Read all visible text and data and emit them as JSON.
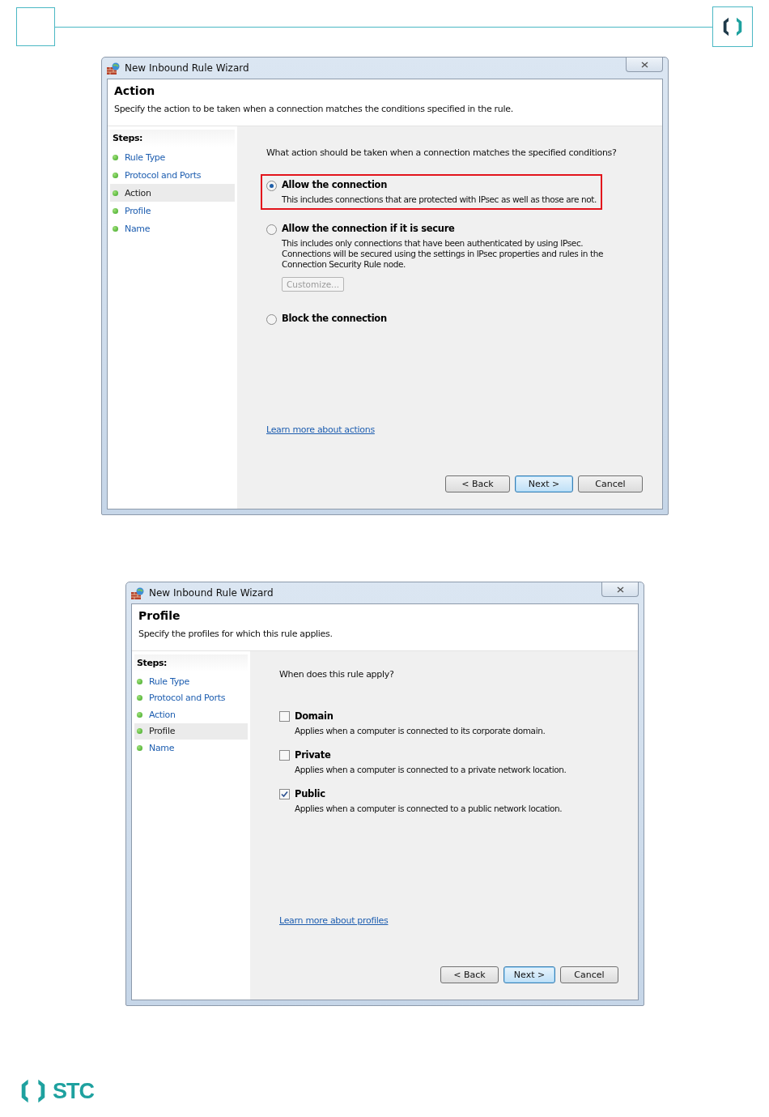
{
  "header": {
    "logo": true
  },
  "windows": [
    {
      "title": "New Inbound Rule Wizard",
      "heading": "Action",
      "subtitle": "Specify the action to be taken when a connection matches the conditions specified in the rule.",
      "steps_label": "Steps:",
      "steps": [
        {
          "label": "Rule Type",
          "selected": false
        },
        {
          "label": "Protocol and Ports",
          "selected": false
        },
        {
          "label": "Action",
          "selected": true
        },
        {
          "label": "Profile",
          "selected": false
        },
        {
          "label": "Name",
          "selected": false
        }
      ],
      "question": "What action should be taken when a connection matches the specified conditions?",
      "options": [
        {
          "kind": "radio",
          "label": "Allow the connection",
          "description": "This includes connections that are protected with IPsec as well as those are not.",
          "selected": true,
          "highlighted": true
        },
        {
          "kind": "radio",
          "label": "Allow the connection if it is secure",
          "description": "This includes only connections that have been authenticated by using IPsec.  Connections will be secured using the settings in IPsec properties and rules in the Connection Security Rule node.",
          "selected": false,
          "highlighted": false,
          "button": {
            "label": "Customize...",
            "disabled": true
          }
        },
        {
          "kind": "radio",
          "label": "Block the connection",
          "selected": false,
          "highlighted": false
        }
      ],
      "link": "Learn more about actions",
      "buttons": [
        {
          "label": "< Back",
          "default": false
        },
        {
          "label": "Next >",
          "default": true
        },
        {
          "label": "Cancel",
          "default": false
        }
      ]
    },
    {
      "title": "New Inbound Rule Wizard",
      "heading": "Profile",
      "subtitle": "Specify the profiles for which this rule applies.",
      "steps_label": "Steps:",
      "steps": [
        {
          "label": "Rule Type",
          "selected": false
        },
        {
          "label": "Protocol and Ports",
          "selected": false
        },
        {
          "label": "Action",
          "selected": false
        },
        {
          "label": "Profile",
          "selected": true
        },
        {
          "label": "Name",
          "selected": false
        }
      ],
      "question": "When does this rule apply?",
      "options": [
        {
          "kind": "checkbox",
          "label": "Domain",
          "description": "Applies when a computer is connected to its corporate domain.",
          "checked": false
        },
        {
          "kind": "checkbox",
          "label": "Private",
          "description": "Applies when a computer is connected to a private network location.",
          "checked": false
        },
        {
          "kind": "checkbox",
          "label": "Public",
          "description": "Applies when a computer is connected to a public network location.",
          "checked": true
        }
      ],
      "link": "Learn more about profiles",
      "buttons": [
        {
          "label": "< Back",
          "default": false
        },
        {
          "label": "Next >",
          "default": true
        },
        {
          "label": "Cancel",
          "default": false
        }
      ]
    }
  ],
  "footer": {
    "brand": "STC"
  }
}
